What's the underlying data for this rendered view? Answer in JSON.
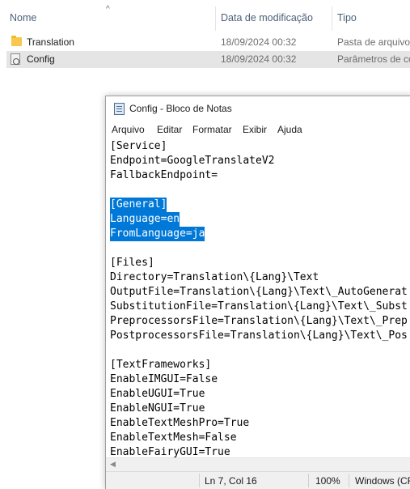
{
  "explorer": {
    "columns": {
      "name": "Nome",
      "date": "Data de modificação",
      "type": "Tipo"
    },
    "files": [
      {
        "name": "Translation",
        "date": "18/09/2024 00:32",
        "type": "Pasta de arquivos",
        "icon": "folder-icon",
        "selected": false
      },
      {
        "name": "Config",
        "date": "18/09/2024 00:32",
        "type": "Parâmetros de co",
        "icon": "config-file-icon",
        "selected": true
      }
    ]
  },
  "notepad": {
    "title": "Config - Bloco de Notas",
    "menu": [
      "Arquivo",
      "Editar",
      "Formatar",
      "Exibir",
      "Ajuda"
    ],
    "lines": [
      {
        "text": "[Service]",
        "selected": false
      },
      {
        "text": "Endpoint=GoogleTranslateV2",
        "selected": false
      },
      {
        "text": "FallbackEndpoint=",
        "selected": false
      },
      {
        "text": "",
        "selected": false
      },
      {
        "text": "[General]",
        "selected": true
      },
      {
        "text": "Language=en",
        "selected": true
      },
      {
        "text": "FromLanguage=ja",
        "selected": true
      },
      {
        "text": "",
        "selected": false
      },
      {
        "text": "[Files]",
        "selected": false
      },
      {
        "text": "Directory=Translation\\{Lang}\\Text",
        "selected": false
      },
      {
        "text": "OutputFile=Translation\\{Lang}\\Text\\_AutoGenerat",
        "selected": false
      },
      {
        "text": "SubstitutionFile=Translation\\{Lang}\\Text\\_Subst",
        "selected": false
      },
      {
        "text": "PreprocessorsFile=Translation\\{Lang}\\Text\\_Prep",
        "selected": false
      },
      {
        "text": "PostprocessorsFile=Translation\\{Lang}\\Text\\_Pos",
        "selected": false
      },
      {
        "text": "",
        "selected": false
      },
      {
        "text": "[TextFrameworks]",
        "selected": false
      },
      {
        "text": "EnableIMGUI=False",
        "selected": false
      },
      {
        "text": "EnableUGUI=True",
        "selected": false
      },
      {
        "text": "EnableNGUI=True",
        "selected": false
      },
      {
        "text": "EnableTextMeshPro=True",
        "selected": false
      },
      {
        "text": "EnableTextMesh=False",
        "selected": false
      },
      {
        "text": "EnableFairyGUI=True",
        "selected": false
      }
    ],
    "status": {
      "position": "Ln 7, Col 16",
      "zoom": "100%",
      "encoding": "Windows (CR"
    },
    "selection_color": "#0078d7"
  }
}
